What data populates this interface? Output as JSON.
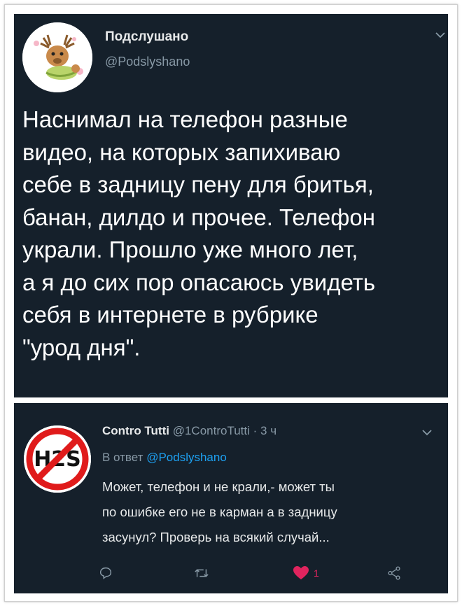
{
  "main_tweet": {
    "display_name": "Подслушано",
    "handle": "@Podslyshano",
    "text": "Наснимал на телефон разные\nвидео, на которых запихиваю\nсебе в задницу пену для бритья,\nбанан, дилдо и прочее. Телефон\nукрали. Прошло уже много лет,\nа я до сих пор опасаюсь увидеть\nсебя в интернете в рубрике\n\"урод дня\"."
  },
  "reply_tweet": {
    "display_name": "Contro Tutti",
    "handle": "@1ControTutti",
    "separator": "·",
    "time": "3 ч",
    "reply_to_label": "В ответ",
    "reply_to_handle": "@Podslyshano",
    "text": "Может, телефон и не крали,- может ты\nпо ошибке его не в карман а в задницу\nзасунул? Проверь на всякий случай...",
    "like_count": "1",
    "avatar_text": "H2S"
  },
  "colors": {
    "card_bg": "#15202b",
    "muted": "#8899a6",
    "link": "#1da1f2",
    "like": "#e0245e"
  },
  "icons": [
    "chevron-down-icon",
    "reply-icon",
    "retweet-icon",
    "heart-icon",
    "share-icon"
  ]
}
